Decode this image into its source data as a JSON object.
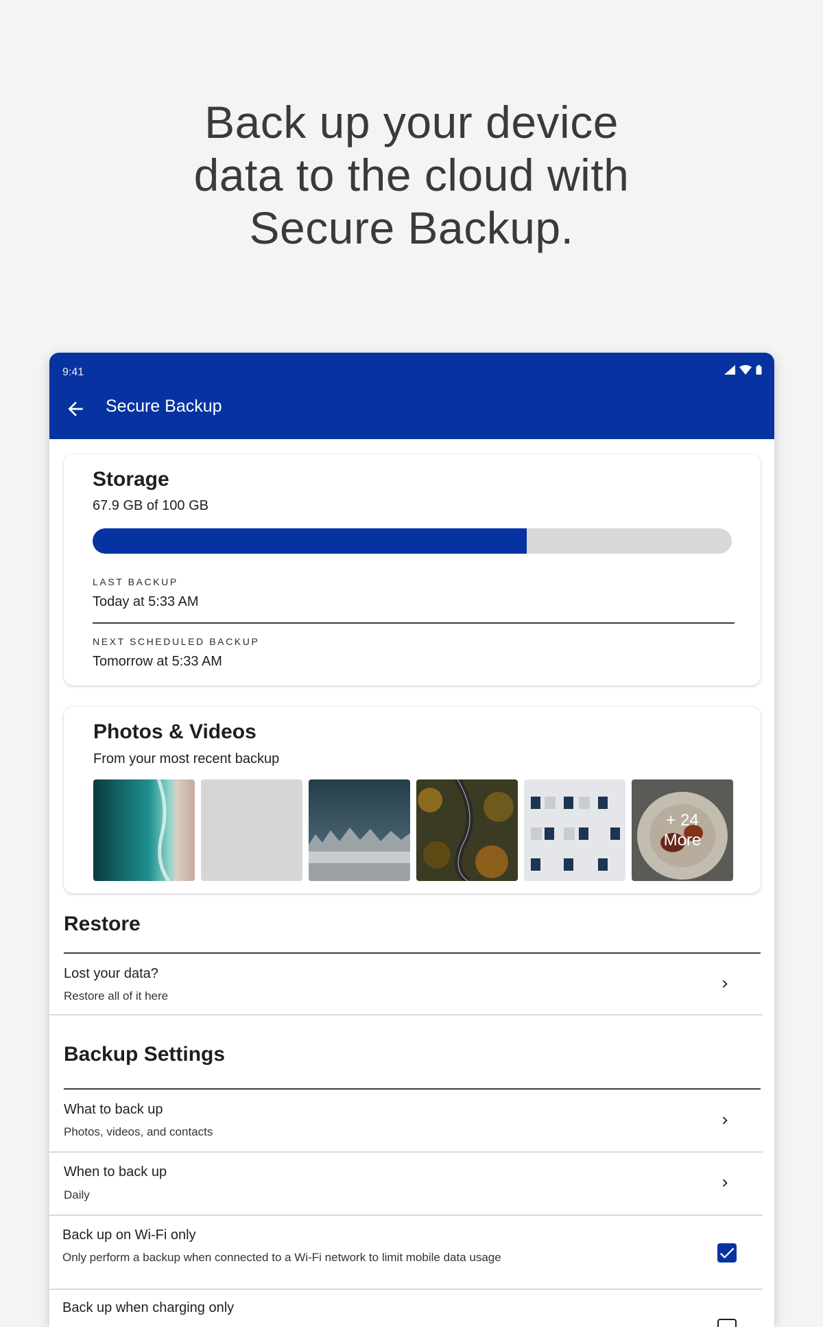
{
  "headline": {
    "line1": "Back up your device",
    "line2": "data to the cloud with",
    "line3": "Secure Backup."
  },
  "status_bar": {
    "time": "9:41",
    "icons": [
      "signal-icon",
      "wifi-icon",
      "battery-icon"
    ]
  },
  "app_bar": {
    "title": "Secure Backup",
    "back_icon": "arrow-left-icon"
  },
  "storage": {
    "title": "Storage",
    "usage_text": "67.9 GB of 100 GB",
    "used_fraction": 0.679,
    "last_backup_label": "LAST BACKUP",
    "last_backup_value": "Today at 5:33 AM",
    "next_backup_label": "NEXT SCHEDULED BACKUP",
    "next_backup_value": "Tomorrow at 5:33 AM"
  },
  "photos": {
    "title": "Photos & Videos",
    "subtitle": "From your most recent backup",
    "thumbnails": [
      "aerial-beach-photo",
      "placeholder",
      "snowy-forest-photo",
      "autumn-road-photo",
      "building-facade-photo",
      "food-plate-photo"
    ],
    "more_count": "+ 24",
    "more_label": "More"
  },
  "restore": {
    "title": "Restore",
    "items": [
      {
        "title": "Lost your data?",
        "subtitle": "Restore all of it here"
      }
    ]
  },
  "backup_settings": {
    "title": "Backup Settings",
    "items": [
      {
        "title": "What to back up",
        "subtitle": "Photos, videos, and contacts"
      },
      {
        "title": "When to back up",
        "subtitle": "Daily"
      }
    ],
    "toggles": [
      {
        "title": "Back up on Wi-Fi only",
        "subtitle": "Only perform a backup when connected to a Wi-Fi network to limit mobile data usage",
        "checked": true
      },
      {
        "title": "Back up when charging only",
        "checked": false
      }
    ]
  },
  "colors": {
    "primary": "#0733a2",
    "track": "#d8d8d8",
    "background": "#f4f4f4"
  }
}
